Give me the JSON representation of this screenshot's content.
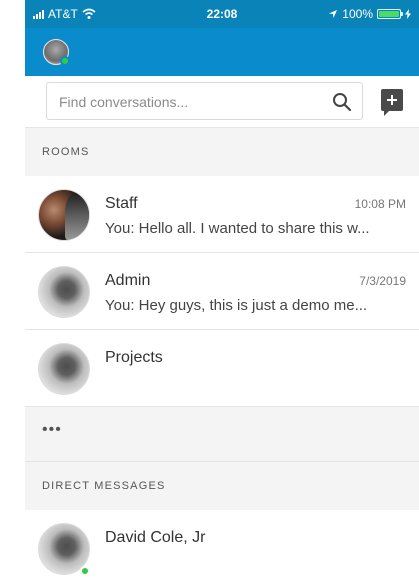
{
  "status_bar": {
    "carrier": "AT&T",
    "time": "22:08",
    "battery": "100%"
  },
  "search": {
    "placeholder": "Find conversations..."
  },
  "sections": {
    "rooms": "ROOMS",
    "direct_messages": "DIRECT MESSAGES"
  },
  "rooms": [
    {
      "title": "Staff",
      "time": "10:08 PM",
      "preview": "You: Hello all. I wanted to share this w..."
    },
    {
      "title": "Admin",
      "time": "7/3/2019",
      "preview": "You: Hey guys, this is just a demo me..."
    },
    {
      "title": "Projects",
      "time": "",
      "preview": ""
    }
  ],
  "more_label": "•••",
  "direct_messages": [
    {
      "title": "David Cole, Jr",
      "status": "online"
    }
  ],
  "colors": {
    "header_blue": "#0a8ccc",
    "online_green": "#2ecc40"
  }
}
